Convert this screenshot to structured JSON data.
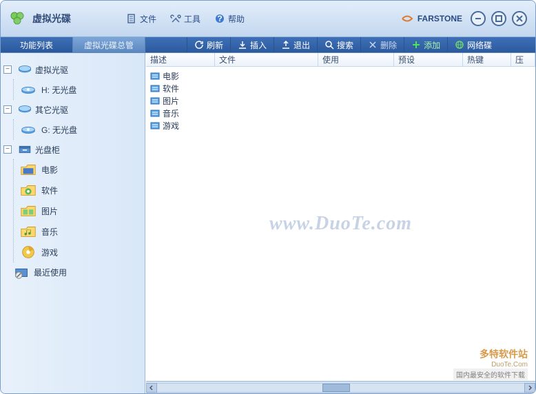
{
  "app": {
    "title": "虚拟光碟",
    "brand": "FARSTONE"
  },
  "menu": {
    "file": "文件",
    "tools": "工具",
    "help": "帮助"
  },
  "sidebar_tabs": {
    "active": "功能列表",
    "inactive": "虚拟光碟总管"
  },
  "toolbar": {
    "refresh": "刷新",
    "insert": "插入",
    "exit": "退出",
    "search": "搜索",
    "delete": "删除",
    "add": "添加",
    "netdisk": "网络碟"
  },
  "tree": {
    "virtual_drive": {
      "label": "虚拟光驱",
      "child_label": "H: 无光盘"
    },
    "other_drive": {
      "label": "其它光驱",
      "child_label": "G: 无光盘"
    },
    "cabinet": {
      "label": "光盘柜",
      "children": {
        "movies": "电影",
        "software": "软件",
        "pictures": "图片",
        "music": "音乐",
        "games": "游戏"
      }
    },
    "recent": {
      "label": "最近使用"
    }
  },
  "columns": {
    "c0": "描述",
    "c1": "文件",
    "c2": "使用",
    "c3": "预设",
    "c4": "热键",
    "c5": "压"
  },
  "list": {
    "r0": "电影",
    "r1": "软件",
    "r2": "图片",
    "r3": "音乐",
    "r4": "游戏"
  },
  "watermark": "www.DuoTe.com",
  "footer": {
    "top": "多特软件站",
    "mid": "DuoTe.Com",
    "bot": "国内最安全的软件下载"
  }
}
